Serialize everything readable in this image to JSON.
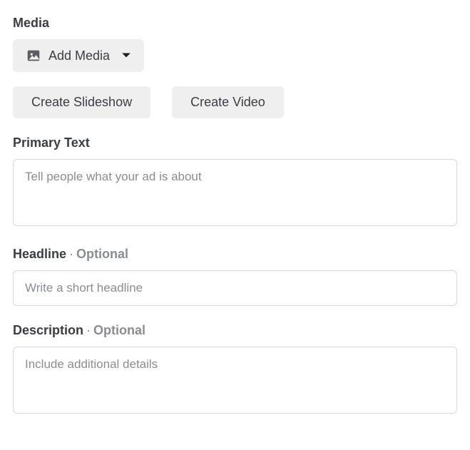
{
  "media": {
    "label": "Media",
    "addMedia": "Add Media",
    "createSlideshow": "Create Slideshow",
    "createVideo": "Create Video"
  },
  "primaryText": {
    "label": "Primary Text",
    "placeholder": "Tell people what your ad is about"
  },
  "headline": {
    "label": "Headline",
    "optional": "Optional",
    "placeholder": "Write a short headline"
  },
  "description": {
    "label": "Description",
    "optional": "Optional",
    "placeholder": "Include additional details"
  }
}
